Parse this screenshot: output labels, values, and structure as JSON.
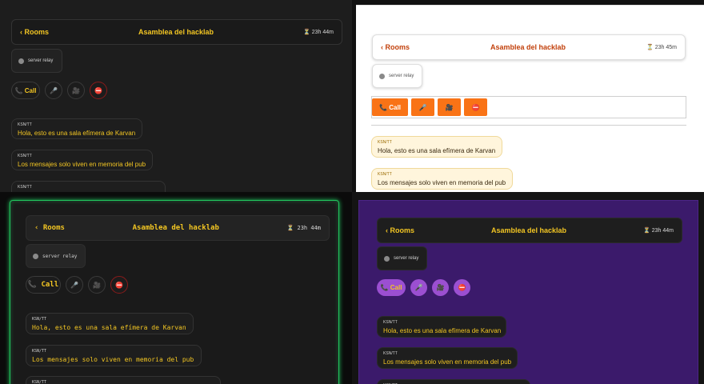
{
  "room": {
    "back_label": "‹ Rooms",
    "title": "Asamblea del hacklab"
  },
  "timers": {
    "dark": "⏳ 23h 44m",
    "light": "⏳ 23h 45m",
    "terminal": "⏳ 23h 44m",
    "purple": "⏳ 23h 44m"
  },
  "relay_label": "server relay",
  "call_label": "📞 Call",
  "controls": {
    "mic_icon": "🎤",
    "camera_icon": "🎥",
    "end_icon": "⛔"
  },
  "messages": [
    {
      "sender": "KSN/TT",
      "text": "Hola, esto es una sala efímera de Karvan"
    },
    {
      "sender": "KSN/TT",
      "text": "Los mensajes solo viven en memoria del pub"
    },
    {
      "sender": "KSN/TT",
      "text": ""
    }
  ],
  "themes": [
    "dark",
    "light",
    "terminal",
    "purple"
  ],
  "colors": {
    "accent_yellow": "#f3c623",
    "accent_orange": "#f97316",
    "terminal_green": "#22c55e",
    "purple_bg": "#3b1a6b",
    "purple_button": "#9b4fd1",
    "end_red": "#ff4d4d"
  }
}
